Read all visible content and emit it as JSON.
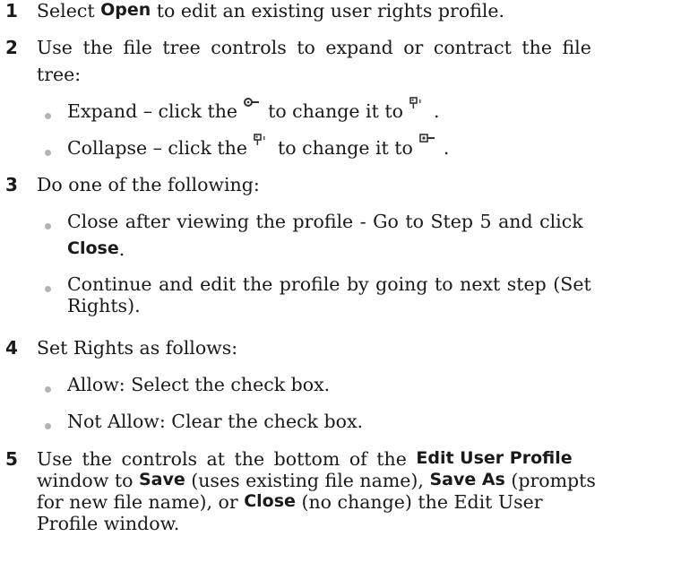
{
  "steps": [
    {
      "num": "1",
      "lines": [
        [
          "Select ",
          "Open",
          " to edit an existing user rights profile."
        ]
      ]
    },
    {
      "num": "2",
      "lines": [
        "Use the file tree controls to expand or contract the file",
        "tree:"
      ],
      "bullets": [
        {
          "a": "Expand – click the",
          "b": "to change it to",
          "c": ".",
          "icon1": "expand-node-icon",
          "icon2": "collapse-node-icon"
        },
        {
          "a": "Collapse – click the",
          "b": "to change it to",
          "c": ".",
          "icon1": "collapse-node-icon",
          "icon2": "expand-node-icon"
        }
      ]
    },
    {
      "num": "3",
      "lines": [
        "Do one of the following:"
      ],
      "bullets": [
        {
          "l1": "Close after viewing the profile - Go to Step 5 and click",
          "l2b": "Close",
          "l2": "."
        },
        {
          "l1": "Continue and edit the profile by going to next step (Set",
          "l2": "Rights)."
        }
      ]
    },
    {
      "num": "4",
      "lines": [
        "Set Rights as follows:"
      ],
      "bullets": [
        {
          "l1": "Allow: Select the check box."
        },
        {
          "l1": "Not Allow: Clear the check box."
        }
      ]
    },
    {
      "num": "5",
      "l1a": "Use the controls at the bottom of the ",
      "l1b": "Edit User Profile",
      "l2a": "window to ",
      "l2b": "Save",
      "l2c": " (uses existing file name), ",
      "l2d": "Save As",
      "l2e": " (prompts",
      "l3a": "for new file name), or ",
      "l3b": "Close",
      "l3c": " (no change) the Edit User",
      "l4": "Profile window."
    }
  ],
  "icons": {
    "expand": "expand-node-icon",
    "collapse": "collapse-node-icon"
  }
}
